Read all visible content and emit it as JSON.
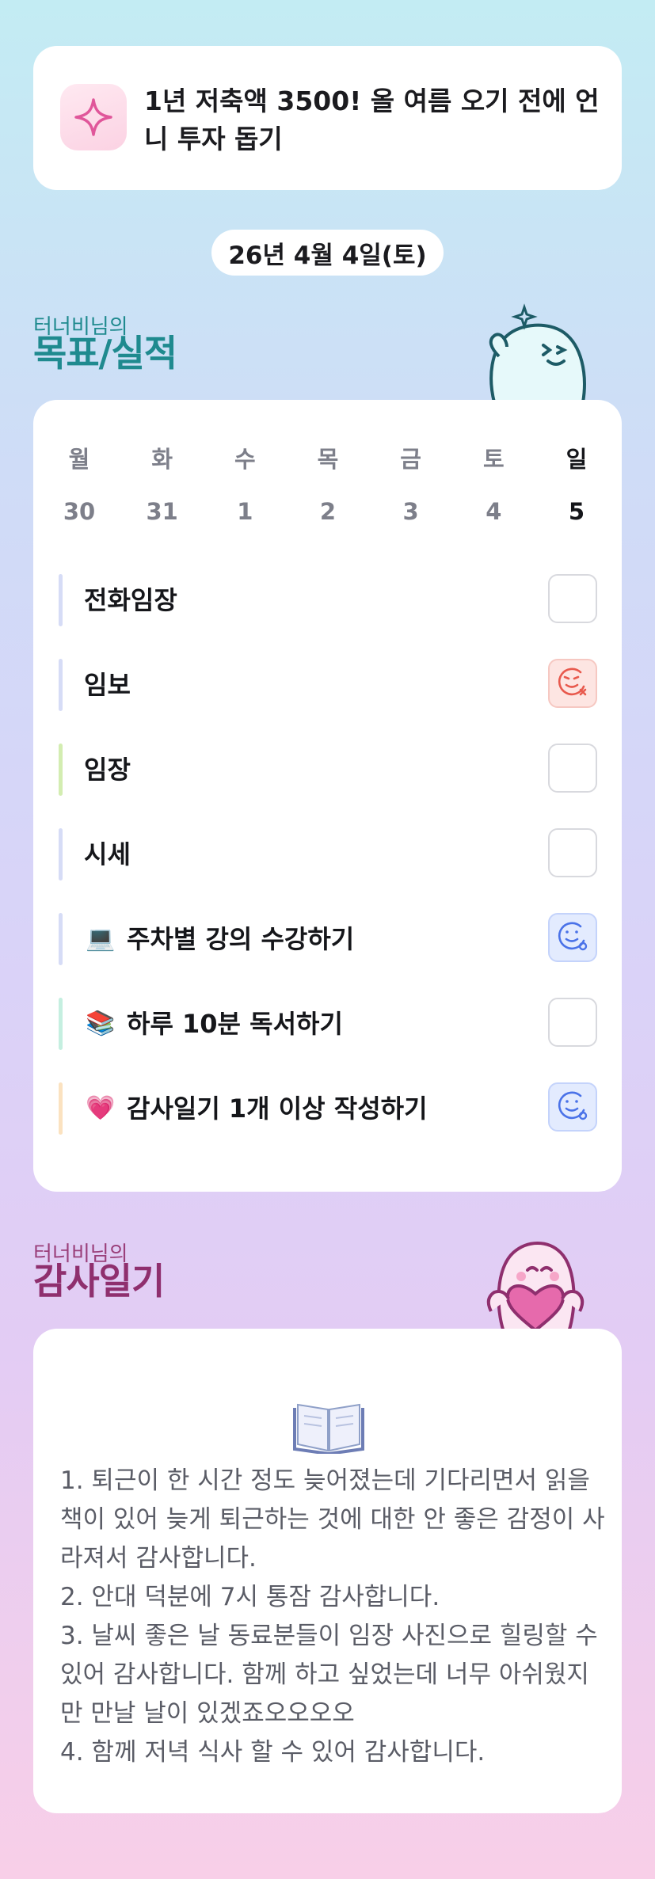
{
  "goal": {
    "icon": "sparkle-icon",
    "text": "1년 저축액 3500! 올 여름 오기 전에 언니 투자 돕기"
  },
  "date": "26년 4월 4일(토)",
  "goals_section": {
    "subtitle": "터너비님의",
    "title": "목표/실적",
    "mascot": "mascot-thumbs-up"
  },
  "week": {
    "weekdays": [
      "월",
      "화",
      "수",
      "목",
      "금",
      "토",
      "일"
    ],
    "dates": [
      "30",
      "31",
      "1",
      "2",
      "3",
      "4",
      "5"
    ],
    "today_index": 6
  },
  "tasks": [
    {
      "label": "전화임장",
      "emoji": "",
      "bar_color": "#d6dcf6",
      "status": "empty"
    },
    {
      "label": "임보",
      "emoji": "",
      "bar_color": "#d6dcf6",
      "status": "failed"
    },
    {
      "label": "임장",
      "emoji": "",
      "bar_color": "#d3edb1",
      "status": "empty"
    },
    {
      "label": "시세",
      "emoji": "",
      "bar_color": "#d6dcf6",
      "status": "empty"
    },
    {
      "label": "주차별 강의 수강하기",
      "emoji": "💻",
      "bar_color": "#d6dcf6",
      "status": "done"
    },
    {
      "label": "하루 10분 독서하기",
      "emoji": "📚",
      "bar_color": "#c5efe0",
      "status": "empty"
    },
    {
      "label": "감사일기 1개 이상 작성하기",
      "emoji": "💗",
      "bar_color": "#fbe2c0",
      "status": "done"
    }
  ],
  "diary_section": {
    "subtitle": "터너비님의",
    "title": "감사일기",
    "mascot": "mascot-holding-heart",
    "icon": "open-book-icon",
    "entries": [
      "1. 퇴근이 한 시간 정도 늦어졌는데 기다리면서 읽을 책이 있어 늦게 퇴근하는 것에 대한 안 좋은 감정이 사라져서 감사합니다.",
      "2. 안대 덕분에 7시 통잠 감사합니다.",
      "3. 날씨 좋은 날 동료분들이 임장 사진으로 힐링할 수 있어 감사합니다. 함께 하고 싶었는데 너무 아쉬웠지만 만날 날이 있겠죠오오오오",
      "4. 함께 저녁 식사 할 수 있어 감사합니다."
    ]
  },
  "colors": {
    "teal_title": "#1f8a8f",
    "plum_title": "#8f2f6e",
    "failed": "#e8594d",
    "done": "#4a72e8"
  }
}
